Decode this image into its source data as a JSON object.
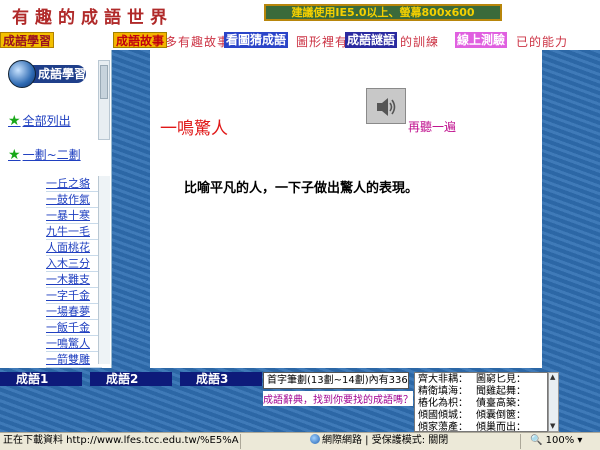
{
  "header": {
    "site_title": "有趣的成語世界",
    "resolution_banner": "建議使用IE5.0以上、螢幕800x600"
  },
  "menu": {
    "marquee_text": "看有很多有趣故事",
    "marquee_mid": "圖形裡有",
    "marquee_mid2": "的訓練",
    "marquee_end": "已的能力",
    "items": [
      "成語學習",
      "成語故事",
      "看圖猜成語",
      "成語謎語",
      "線上測驗"
    ]
  },
  "sidebar": {
    "badge_label": "成語學習",
    "category_all": "全部列出",
    "category_strokes": "一劃~二劃",
    "idioms": [
      "一丘之貉",
      "一鼓作氣",
      "一暴十寒",
      "九牛一毛",
      "人面桃花",
      "入木三分",
      "一木難支",
      "一字千金",
      "一場春夢",
      "一飯千金",
      "一鳴驚人",
      "一箭雙雕"
    ]
  },
  "content": {
    "idiom": "一鳴驚人",
    "replay_label": "再聽一遍",
    "meaning": "比喻平凡的人，一下子做出驚人的表現。"
  },
  "bottom": {
    "tabs": [
      "成語1",
      "成語2",
      "成語3"
    ],
    "stroke_info": "首字筆劃(13劃~14劃)內有336句",
    "dict_link": "成語辭典，找到你要找的成語嗎？",
    "idiom_pairs": [
      [
        "齊大非耦：",
        "圖窮匕見："
      ],
      [
        "精衛填海：",
        "聞雞起舞："
      ],
      [
        "樁化為枳：",
        "債臺高築："
      ],
      [
        "傾國傾城：",
        "傾囊倒篋："
      ],
      [
        "傾家蕩產：",
        "傾巢而出："
      ]
    ]
  },
  "statusbar": {
    "loading": "正在下載資料 http://www.lfes.tcc.edu.tw/%E5%A",
    "zone": "網際網路 | 受保護模式: 關閉",
    "zoom": "100%"
  }
}
